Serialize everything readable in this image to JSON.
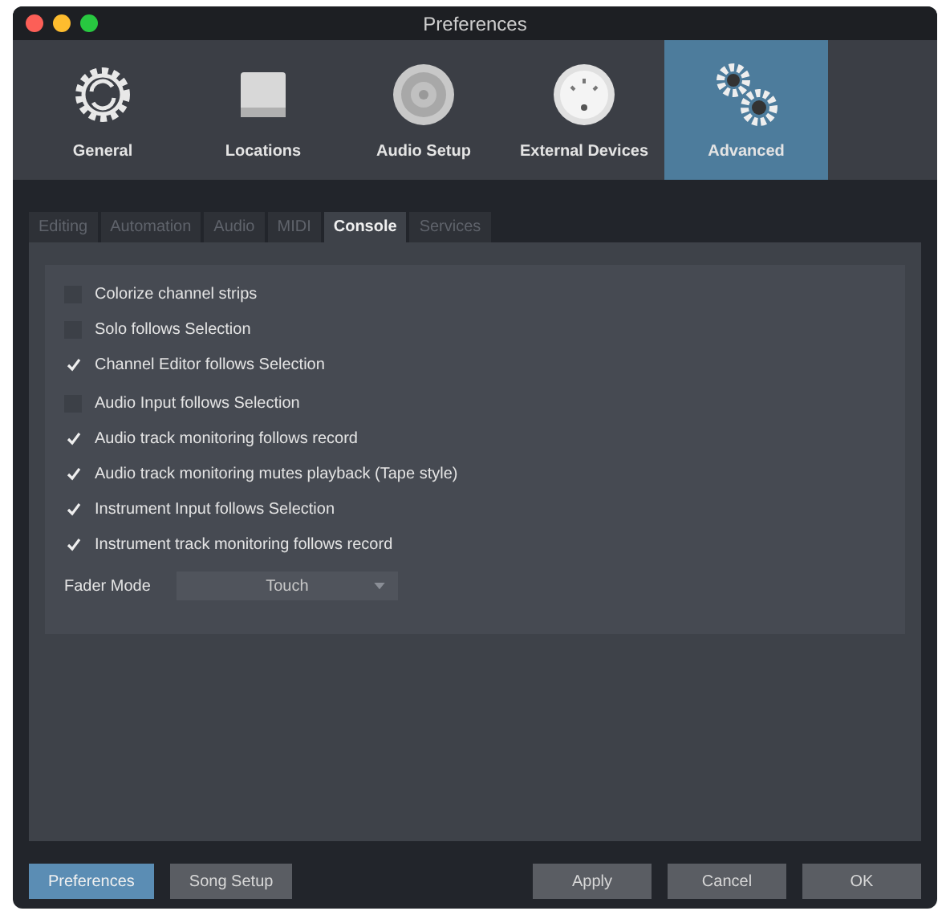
{
  "window": {
    "title": "Preferences"
  },
  "toolbar": [
    {
      "label": "General",
      "selected": false
    },
    {
      "label": "Locations",
      "selected": false
    },
    {
      "label": "Audio Setup",
      "selected": false
    },
    {
      "label": "External Devices",
      "selected": false
    },
    {
      "label": "Advanced",
      "selected": true
    }
  ],
  "tabs": [
    {
      "label": "Editing",
      "selected": false
    },
    {
      "label": "Automation",
      "selected": false
    },
    {
      "label": "Audio",
      "selected": false
    },
    {
      "label": "MIDI",
      "selected": false
    },
    {
      "label": "Console",
      "selected": true
    },
    {
      "label": "Services",
      "selected": false
    }
  ],
  "option_groups": [
    [
      {
        "label": "Colorize channel strips",
        "checked": false
      },
      {
        "label": "Solo follows Selection",
        "checked": false
      },
      {
        "label": "Channel Editor follows Selection",
        "checked": true
      }
    ],
    [
      {
        "label": "Audio Input follows Selection",
        "checked": false
      },
      {
        "label": "Audio track monitoring follows record",
        "checked": true
      },
      {
        "label": "Audio track monitoring mutes playback (Tape style)",
        "checked": true
      },
      {
        "label": "Instrument Input follows Selection",
        "checked": true
      },
      {
        "label": "Instrument track monitoring follows record",
        "checked": true
      }
    ]
  ],
  "fader_mode": {
    "label": "Fader Mode",
    "value": "Touch"
  },
  "footer_left": [
    {
      "label": "Preferences",
      "selected": true
    },
    {
      "label": "Song Setup",
      "selected": false
    }
  ],
  "footer_right": [
    "Apply",
    "Cancel",
    "OK"
  ]
}
